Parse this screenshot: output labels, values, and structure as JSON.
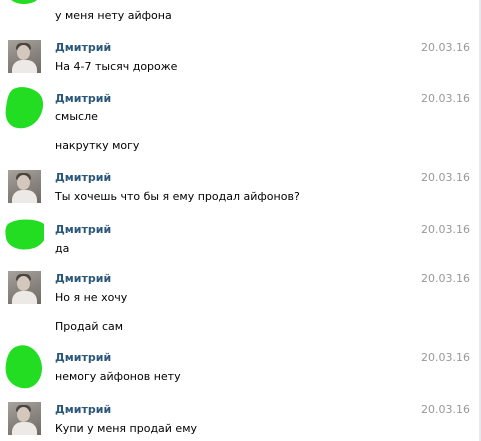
{
  "colors": {
    "author": "#2b587a",
    "date": "#999999",
    "censor": "#22dd22"
  },
  "messages": [
    {
      "author": "",
      "date": "",
      "avatar": "censored-blob",
      "lines": [
        "у меня нету айфона"
      ]
    },
    {
      "author": "Дмитрий",
      "date": "20.03.16",
      "avatar": "user-photo",
      "lines": [
        "На 4-7 тысяч дороже"
      ]
    },
    {
      "author": "Дмитрий",
      "date": "20.03.16",
      "avatar": "censored-blob",
      "lines": [
        "смысле",
        "накрутку могу"
      ]
    },
    {
      "author": "Дмитрий",
      "date": "20.03.16",
      "avatar": "user-photo",
      "lines": [
        "Ты хочешь что бы я ему продал айфонов?"
      ]
    },
    {
      "author": "Дмитрий",
      "date": "20.03.16",
      "avatar": "censored-blob",
      "lines": [
        "да"
      ]
    },
    {
      "author": "Дмитрий",
      "date": "20.03.16",
      "avatar": "user-photo",
      "lines": [
        "Но я не хочу",
        "Продай сам"
      ]
    },
    {
      "author": "Дмитрий",
      "date": "20.03.16",
      "avatar": "censored-blob",
      "lines": [
        "немогу айфонов нету"
      ]
    },
    {
      "author": "Дмитрий",
      "date": "20.03.16",
      "avatar": "user-photo",
      "lines": [
        "Купи у меня продай ему"
      ]
    }
  ]
}
